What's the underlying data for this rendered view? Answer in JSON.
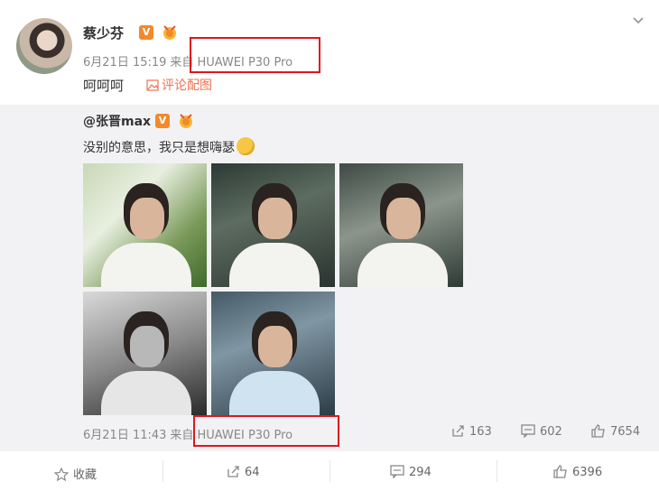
{
  "post": {
    "username": "蔡少芬",
    "v_badge": "V",
    "date": "6月21日 15:19",
    "from_label": "来自",
    "device": "HUAWEI P30 Pro",
    "text": "呵呵呵",
    "comment_pic_label": "评论配图"
  },
  "repost": {
    "username": "@张晋max",
    "v_badge": "V",
    "text": "没别的意思，我只是想嗨瑟",
    "date": "6月21日 11:43",
    "from_label": "来自",
    "device": "HUAWEI P30 Pro",
    "stats": {
      "reposts": "163",
      "comments": "602",
      "likes": "7654"
    }
  },
  "action_bar": {
    "favorite_label": "收藏",
    "repost_count": "64",
    "comment_count": "294",
    "like_count": "6396"
  },
  "colors": {
    "accent": "#eb7350",
    "highlight_box": "#e0161e",
    "v_badge": "#f3892b"
  }
}
